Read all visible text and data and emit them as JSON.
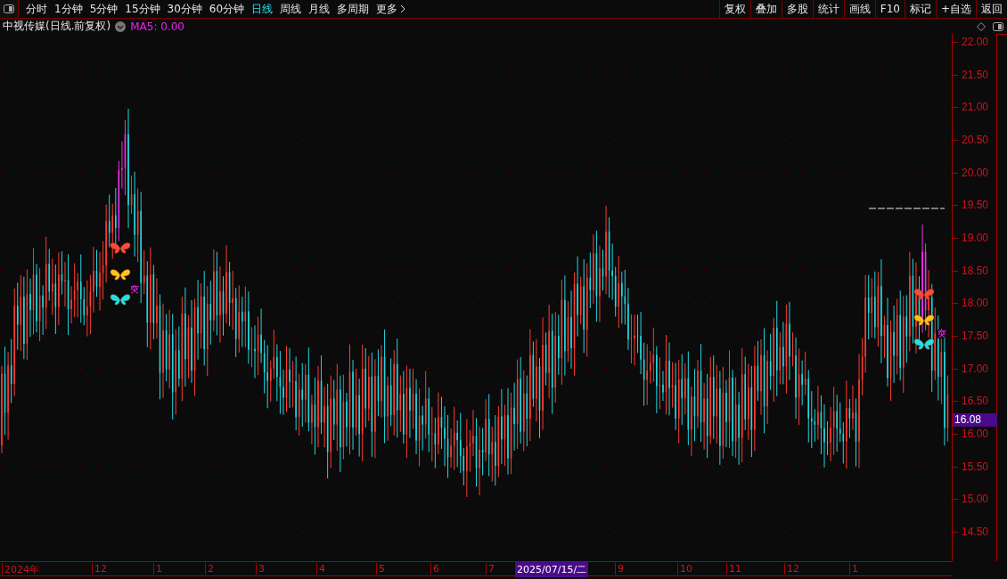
{
  "toolbar": {
    "periods": [
      {
        "label": "分时",
        "selected": false
      },
      {
        "label": "1分钟",
        "selected": false
      },
      {
        "label": "5分钟",
        "selected": false
      },
      {
        "label": "15分钟",
        "selected": false
      },
      {
        "label": "30分钟",
        "selected": false
      },
      {
        "label": "60分钟",
        "selected": false
      },
      {
        "label": "日线",
        "selected": true
      },
      {
        "label": "周线",
        "selected": false
      },
      {
        "label": "月线",
        "selected": false
      },
      {
        "label": "多周期",
        "selected": false
      }
    ],
    "more": "更多",
    "actions": [
      "复权",
      "叠加",
      "多股",
      "统计",
      "画线",
      "F10",
      "标记",
      "+自选",
      "返回"
    ]
  },
  "chart_header": {
    "title": "中视传媒(日线.前复权)",
    "indicator": "MA5: 0.00"
  },
  "price_axis": [
    "22.00",
    "21.50",
    "21.00",
    "20.50",
    "20.00",
    "19.50",
    "19.00",
    "18.50",
    "18.00",
    "17.50",
    "17.00",
    "16.50",
    "16.00",
    "15.50",
    "15.00",
    "14.50"
  ],
  "current_price": "16.08",
  "signals": [
    "突",
    "突"
  ],
  "date_axis": {
    "labels": [
      "2024年",
      "12",
      "1",
      "2",
      "3",
      "4",
      "5",
      "6",
      "7",
      "9",
      "10",
      "11",
      "12",
      "1"
    ],
    "cursor_date": "2025/07/15/二"
  }
}
